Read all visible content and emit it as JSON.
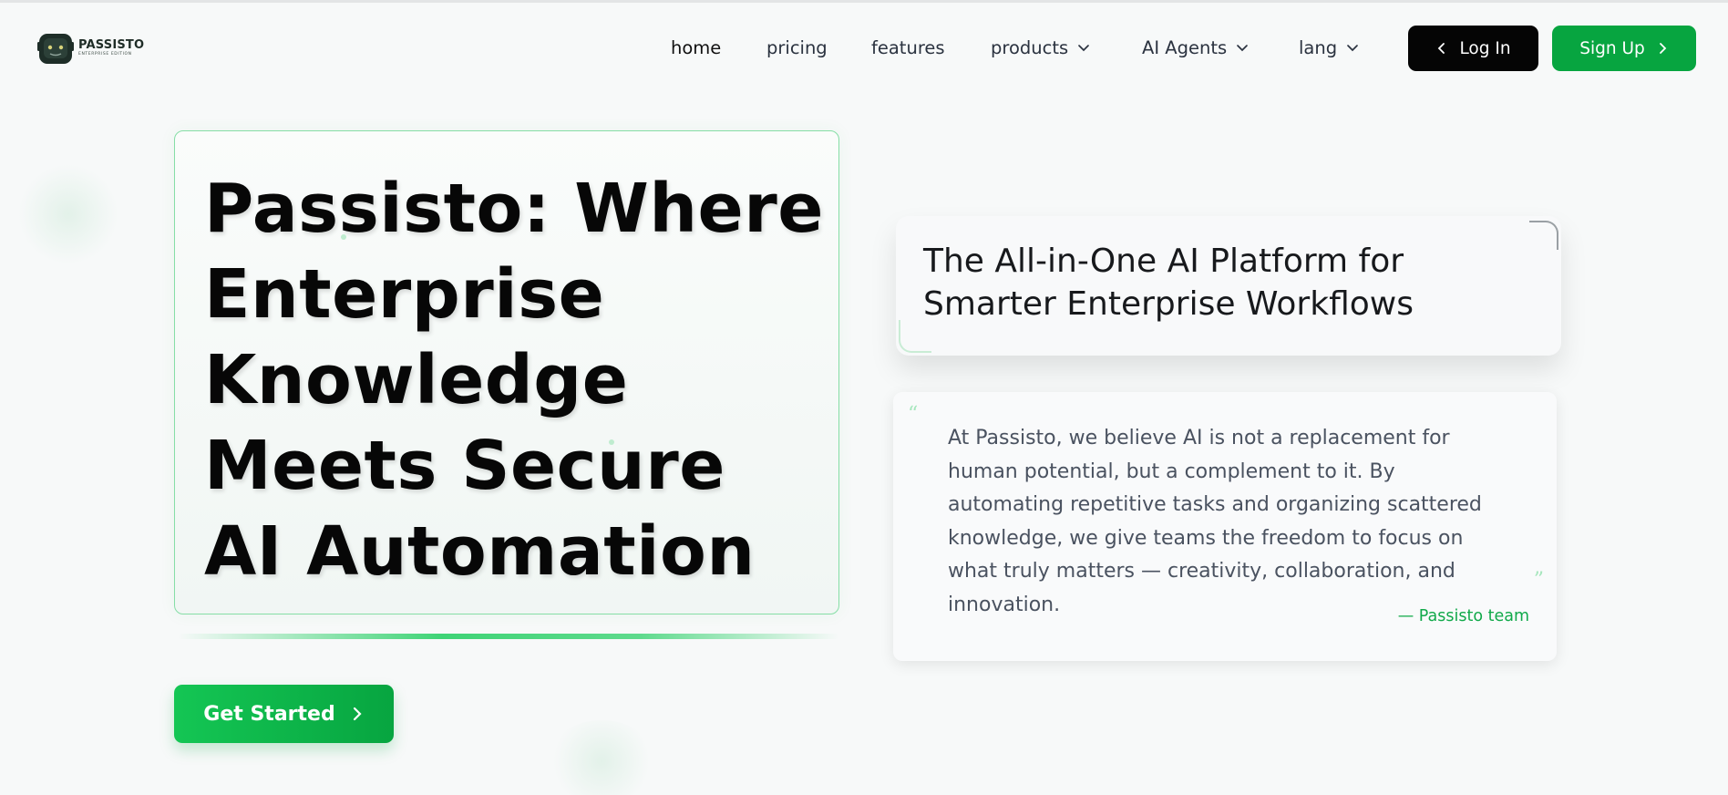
{
  "brand": {
    "name": "PASSISTO",
    "tagline": "ENTERPRISE EDITION",
    "accent_color": "#07a540",
    "dark_color": "#050505"
  },
  "nav": {
    "items": [
      {
        "label": "home",
        "active": true,
        "dropdown": false
      },
      {
        "label": "pricing",
        "active": false,
        "dropdown": false
      },
      {
        "label": "features",
        "active": false,
        "dropdown": false
      },
      {
        "label": "products",
        "active": false,
        "dropdown": true
      },
      {
        "label": "AI Agents",
        "active": false,
        "dropdown": true
      },
      {
        "label": "lang",
        "active": false,
        "dropdown": true
      }
    ],
    "login_label": "Log In",
    "signup_label": "Sign Up"
  },
  "hero": {
    "title": "Passisto: Where Enterprise Knowledge Meets Secure AI Automation",
    "cta_label": "Get Started"
  },
  "tagline": {
    "text": "The All-in-One AI Platform for Smarter Enterprise Workflows"
  },
  "quote": {
    "open_mark": "“",
    "close_mark": "”",
    "text": "At Passisto, we believe AI is not a replacement for human potential, but a complement to it. By automating repetitive tasks and organizing scattered knowledge, we give teams the freedom to focus on what truly matters — creativity, collaboration, and innovation.",
    "author": "— Passisto team"
  },
  "icons": {
    "logo": "robot-head-icon",
    "dropdown": "chevron-down-icon",
    "login": "chevron-left-icon",
    "signup": "chevron-right-icon",
    "cta": "chevron-right-icon"
  }
}
